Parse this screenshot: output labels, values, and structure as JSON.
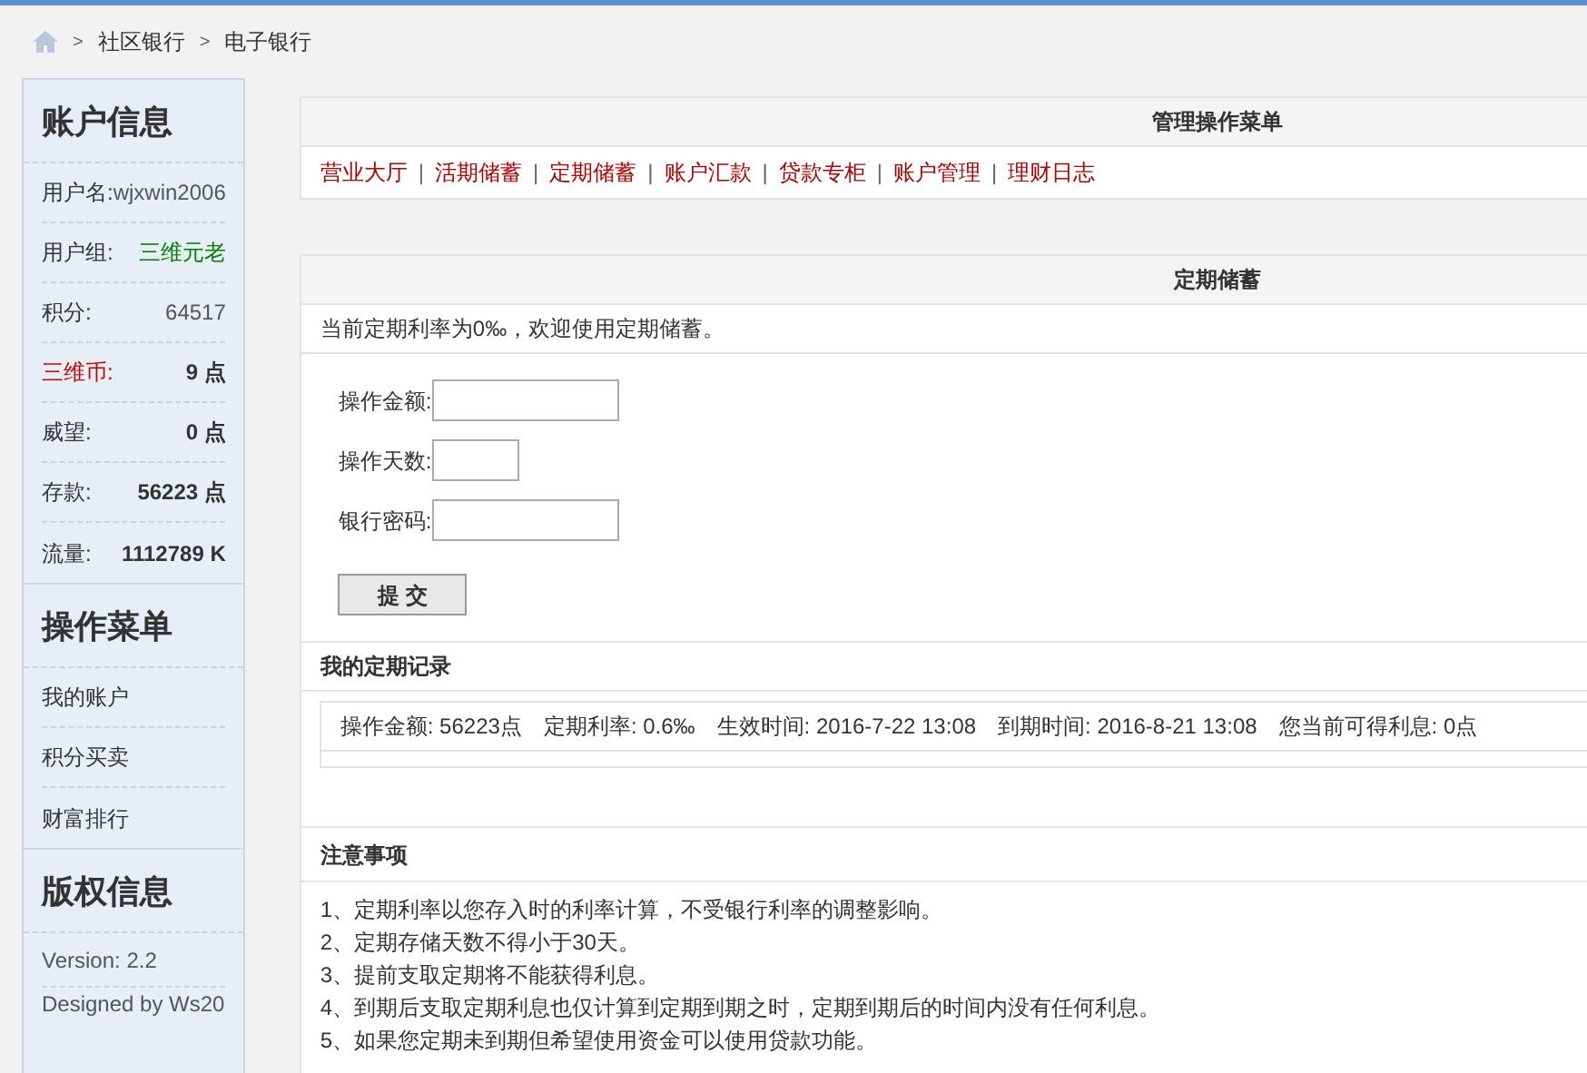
{
  "breadcrumb": [
    {
      "separator": ">",
      "label": "社区银行"
    },
    {
      "separator": ">",
      "label": "电子银行"
    }
  ],
  "account": {
    "title": "账户信息",
    "rows": [
      {
        "label": "用户名:",
        "value": "wjxwin2006",
        "bold": false,
        "highlighted": false,
        "color": "#555555"
      },
      {
        "label": "用户组:",
        "value": "三维元老",
        "bold": false,
        "highlighted": false,
        "color": "#008000"
      },
      {
        "label": "积分:",
        "value": "64517",
        "bold": false,
        "highlighted": false,
        "color": "#555555"
      },
      {
        "label": "三维币:",
        "value": "9 点",
        "bold": true,
        "highlighted": true,
        "color": "#333333"
      },
      {
        "label": "威望:",
        "value": "0 点",
        "bold": true,
        "highlighted": false,
        "color": "#333333"
      },
      {
        "label": "存款:",
        "value": "56223 点",
        "bold": true,
        "highlighted": false,
        "color": "#333333"
      },
      {
        "label": "流量:",
        "value": "1112789 K",
        "bold": true,
        "highlighted": false,
        "color": "#333333"
      }
    ]
  },
  "menu": {
    "title": "操作菜单",
    "items": [
      "我的账户",
      "积分买卖",
      "财富排行"
    ]
  },
  "copyright": {
    "title": "版权信息",
    "lines": [
      "Version: 2.2",
      "Designed by Ws20"
    ]
  },
  "admin_menu": {
    "title": "管理操作菜单",
    "links": [
      {
        "label": "营业大厅"
      },
      {
        "separator": "|",
        "label": "活期储蓄"
      },
      {
        "separator": "|",
        "label": "定期储蓄"
      },
      {
        "separator": "|",
        "label": "账户汇款"
      },
      {
        "separator": "|",
        "label": "贷款专柜"
      },
      {
        "separator": "|",
        "label": "账户管理"
      },
      {
        "separator": "|",
        "label": "理财日志"
      }
    ]
  },
  "deposit": {
    "title": "定期储蓄",
    "notice": "当前定期利率为0‰，欢迎使用定期储蓄。",
    "fields": [
      {
        "label": "操作金额:",
        "kind": "wide"
      },
      {
        "label": "操作天数:",
        "kind": "short"
      },
      {
        "label": "银行密码:",
        "kind": "wide"
      }
    ],
    "submit": "提 交"
  },
  "records": {
    "title": "我的定期记录",
    "rows": [
      [
        "操作金额: 56223点",
        "定期利率: 0.6‰",
        "生效时间: 2016-7-22 13:08",
        "到期时间: 2016-8-21 13:08",
        "您当前可得利息: 0点"
      ]
    ]
  },
  "notes": {
    "title": "注意事项",
    "items": [
      "1、定期利率以您存入时的利率计算，不受银行利率的调整影响。",
      "2、定期存储天数不得小于30天。",
      "3、提前支取定期将不能获得利息。",
      "4、到期后支取定期利息也仅计算到定期到期之时，定期到期后的时间内没有任何利息。",
      "5、如果您定期未到期但希望使用资金可以使用贷款功能。"
    ]
  }
}
